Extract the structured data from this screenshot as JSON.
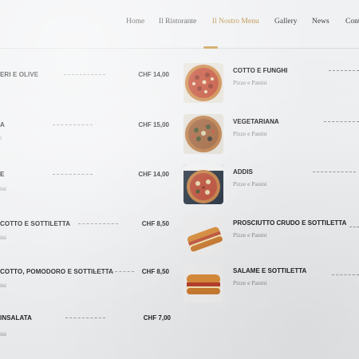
{
  "nav": {
    "items": [
      "Home",
      "Il Ristorante",
      "Il Nostro Menu",
      "Gallery",
      "News",
      "Cont"
    ],
    "active_index": 2
  },
  "menu_left": [
    {
      "title": "ERI E OLIVE",
      "subtitle": "",
      "price": "CHF 14,00"
    },
    {
      "title": "A",
      "subtitle": "i",
      "price": "CHF 15,00"
    },
    {
      "title": "E",
      "subtitle": "ini",
      "price": "CHF 14,00"
    },
    {
      "title": "COTTO E SOTTILETTA",
      "subtitle": "ini",
      "price": "CHF 8,50"
    },
    {
      "title": "COTTO, POMODORO E SOTTILETTA",
      "subtitle": "ini",
      "price": "CHF 8,50"
    },
    {
      "title": "INSALATA",
      "subtitle": "ini",
      "price": "CHF 7,00"
    }
  ],
  "menu_right": [
    {
      "title": "COTTO E FUNGHI",
      "subtitle": "Pizze e Panini",
      "image": "pizza-image"
    },
    {
      "title": "VEGETARIANA",
      "subtitle": "Pizze e Panini",
      "image": "pizza-image"
    },
    {
      "title": "ADDIS",
      "subtitle": "Pizze e Panini",
      "image": "pizza-image"
    },
    {
      "title": "PROSCIUTTO CRUDO E SOTTILETTA",
      "subtitle": "Pizze e Panini",
      "image": "sandwich-image"
    },
    {
      "title": "SALAME E SOTTILETTA",
      "subtitle": "Pizze e Panini",
      "image": "sandwich-image"
    }
  ],
  "colors": {
    "accent": "#b78a3d",
    "text": "#222222",
    "muted": "#8a8a8a"
  }
}
